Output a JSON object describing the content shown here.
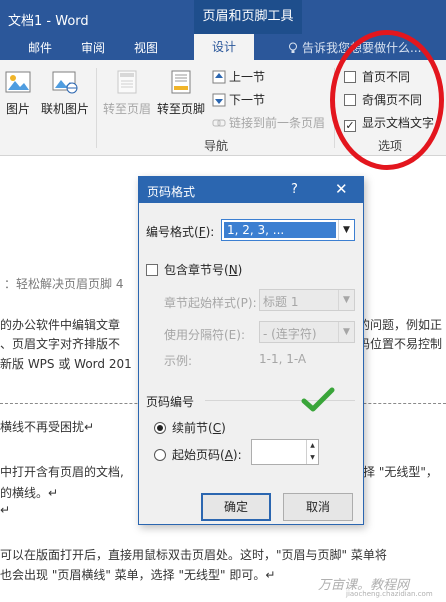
{
  "title_bar": {
    "doc_title": "文档1 - Word",
    "context_tool": "页眉和页脚工具"
  },
  "tabs": {
    "mail": "邮件",
    "review": "审阅",
    "view": "视图",
    "design": "设计",
    "tell_me": "告诉我您想要做什么..."
  },
  "ribbon": {
    "picture": "图片",
    "online_picture": "联机图片",
    "goto_header": "转至页眉",
    "goto_footer": "转至页脚",
    "prev_section": "上一节",
    "next_section": "下一节",
    "link_previous": "链接到前一条页眉",
    "nav_group": "导航",
    "first_page_diff": "首页不同",
    "odd_even_diff": "奇偶页不同",
    "show_doc_text": "显示文档文字",
    "options_group": "选项",
    "first_page_checked": false,
    "odd_even_checked": false,
    "show_doc_text_checked": true
  },
  "document": {
    "line1": "：轻松解决页眉页脚 4",
    "line2a": "的办公软件中编辑文章",
    "line2b": "的问题，例如正",
    "line3a": "、页眉文字对齐排版不",
    "line3b": "码位置不易控制",
    "line4": "新版 WPS 或 Word 201",
    "line5": "横线不再受困扰↵",
    "line6a": "中打开含有页眉的文档,",
    "line6b": "择 \"无线型\"，",
    "line7": "的横线。↵",
    "line8": "↵",
    "line9": "可以在版面打开后，直接用鼠标双击页眉处。这时，\"页眉与页脚\" 菜单将",
    "line10": "也会出现 \"页眉横线\" 菜单，选择 \"无线型\" 即可。↵",
    "watermark": "万亩课。教程网",
    "watermark_url": "jiaocheng.chazidian.com"
  },
  "dialog": {
    "title": "页码格式",
    "help": "?",
    "close": "✕",
    "number_format_label": "编号格式(",
    "number_format_key": "F",
    "number_format_value": "1, 2, 3, ...",
    "include_chapter_label": "包含章节号(",
    "include_chapter_key": "N",
    "chapter_style_label": "章节起始样式(P):",
    "chapter_style_value": "标题 1",
    "separator_label": "使用分隔符(E):",
    "separator_value": "-  (连字符)",
    "example_label": "示例:",
    "example_value": "1-1, 1-A",
    "page_numbering_label": "页码编号",
    "continue_label": "续前节(",
    "continue_key": "C",
    "start_at_label": "起始页码(",
    "start_at_key": "A",
    "start_at_value": "",
    "ok": "确定",
    "cancel": "取消"
  }
}
